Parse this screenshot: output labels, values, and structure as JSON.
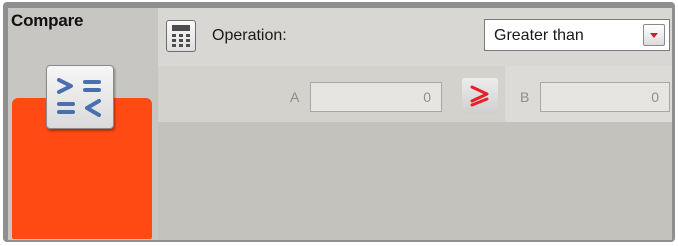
{
  "block": {
    "title": "Compare",
    "icon": "compare-symbols-icon",
    "accent_color": "#ff4a14"
  },
  "config": {
    "calc_icon": "calculator-icon",
    "operation_label": "Operation:",
    "operation_value": "Greater than",
    "dropdown_icon": "chevron-down-icon"
  },
  "inputs": {
    "a_label": "A",
    "a_value": "0",
    "operator_icon": "greater-than-icon",
    "operator_color": "#e8202a",
    "b_label": "B",
    "b_value": "0"
  }
}
